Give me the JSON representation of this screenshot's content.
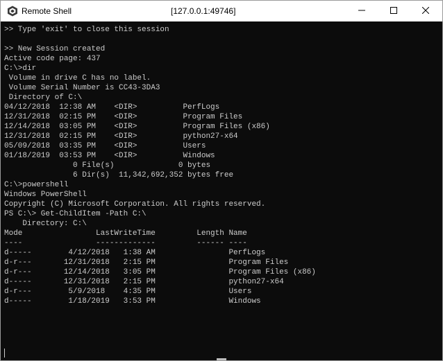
{
  "window": {
    "title": "Remote Shell",
    "address": "[127.0.0.1:49746]",
    "icon": "remote-shell-app-icon",
    "controls": [
      "minimize-icon",
      "maximize-icon",
      "close-icon"
    ]
  },
  "console": {
    "background": "#0c0c0c",
    "foreground": "#cccccc",
    "lines": [
      ">> Type 'exit' to close this session",
      "",
      ">> New Session created",
      "Active code page: 437",
      "C:\\>dir",
      " Volume in drive C has no label.",
      " Volume Serial Number is CC43-3DA3",
      " Directory of C:\\",
      "04/12/2018  12:38 AM    <DIR>          PerfLogs",
      "12/31/2018  02:15 PM    <DIR>          Program Files",
      "12/14/2018  03:05 PM    <DIR>          Program Files (x86)",
      "12/31/2018  02:15 PM    <DIR>          python27-x64",
      "05/09/2018  03:35 PM    <DIR>          Users",
      "01/18/2019  03:53 PM    <DIR>          Windows",
      "               0 File(s)              0 bytes",
      "               6 Dir(s)  11,342,692,352 bytes free",
      "C:\\>powershell",
      "Windows PowerShell",
      "Copyright (C) Microsoft Corporation. All rights reserved.",
      "PS C:\\> Get-ChildItem -Path C:\\",
      "    Directory: C:\\",
      "Mode                LastWriteTime         Length Name",
      "----                -------------         ------ ----",
      "d-----        4/12/2018   1:38 AM                PerfLogs",
      "d-r---       12/31/2018   2:15 PM                Program Files",
      "d-r---       12/14/2018   3:05 PM                Program Files (x86)",
      "d-----       12/31/2018   2:15 PM                python27-x64",
      "d-r---        5/9/2018    4:35 PM                Users",
      "d-----        1/18/2019   3:53 PM                Windows"
    ]
  }
}
